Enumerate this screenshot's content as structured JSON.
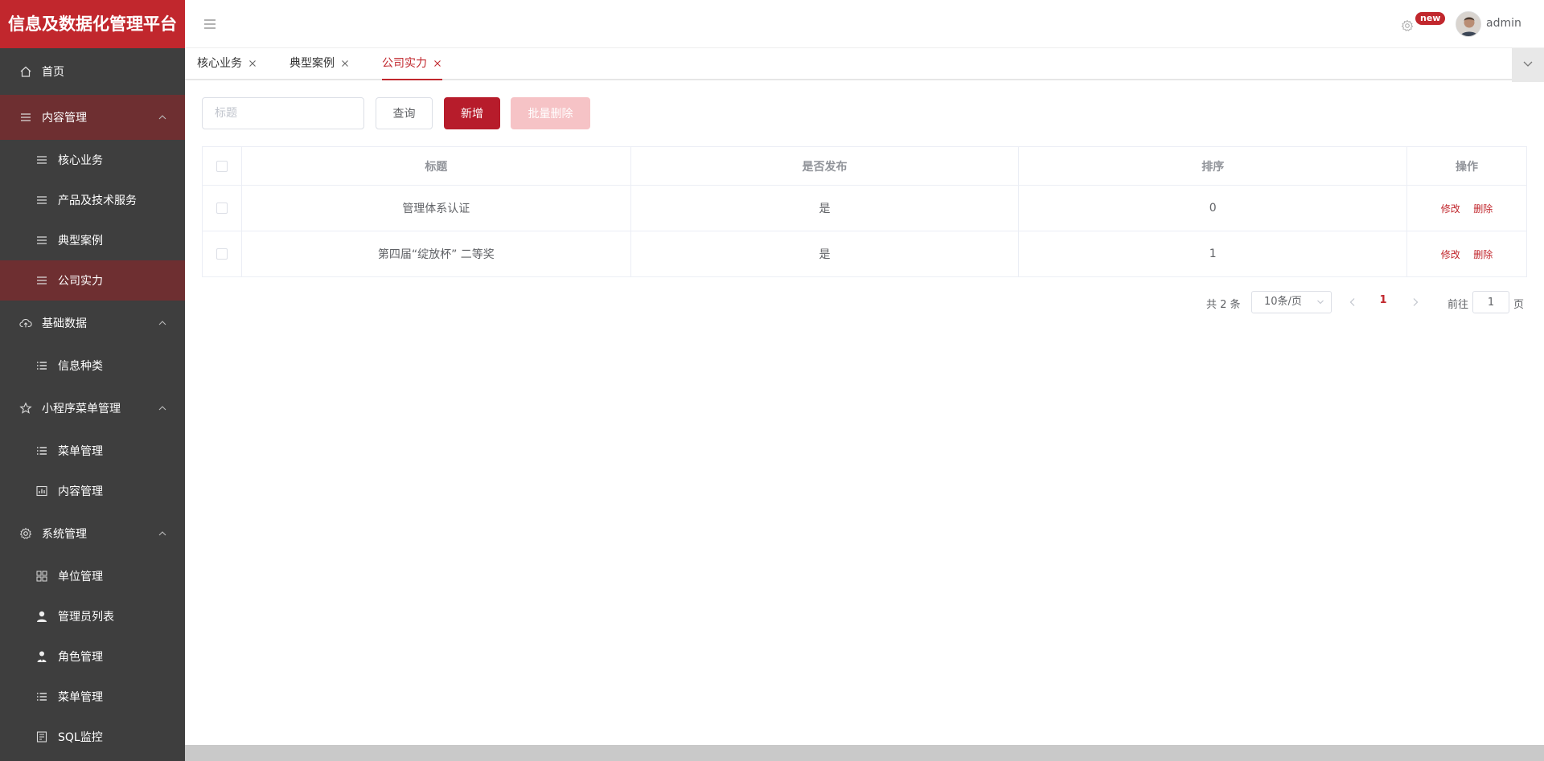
{
  "brand": "信息及数据化管理平台",
  "sidebar": {
    "items": [
      {
        "label": "首页"
      },
      {
        "label": "内容管理"
      },
      {
        "label": "核心业务"
      },
      {
        "label": "产品及技术服务"
      },
      {
        "label": "典型案例"
      },
      {
        "label": "公司实力"
      },
      {
        "label": "基础数据"
      },
      {
        "label": "信息种类"
      },
      {
        "label": "小程序菜单管理"
      },
      {
        "label": "菜单管理"
      },
      {
        "label": "内容管理"
      },
      {
        "label": "系统管理"
      },
      {
        "label": "单位管理"
      },
      {
        "label": "管理员列表"
      },
      {
        "label": "角色管理"
      },
      {
        "label": "菜单管理"
      },
      {
        "label": "SQL监控"
      }
    ]
  },
  "header": {
    "badge": "new",
    "username": "admin"
  },
  "tabs": [
    {
      "label": "核心业务"
    },
    {
      "label": "典型案例"
    },
    {
      "label": "公司实力"
    }
  ],
  "toolbar": {
    "search_placeholder": "标题",
    "query_label": "查询",
    "add_label": "新增",
    "batch_delete_label": "批量删除"
  },
  "table": {
    "headers": [
      "标题",
      "是否发布",
      "排序",
      "操作"
    ],
    "rows": [
      {
        "title": "管理体系认证",
        "published": "是",
        "order": "0",
        "edit": "修改",
        "delete": "删除"
      },
      {
        "title": "第四届“绽放杯” 二等奖",
        "published": "是",
        "order": "1",
        "edit": "修改",
        "delete": "删除"
      }
    ]
  },
  "pager": {
    "total": "共 2 条",
    "page_size": "10条/页",
    "current_page": "1",
    "goto_label": "前往",
    "goto_value": "1",
    "page_label": "页"
  },
  "colors": {
    "brand": "#c1272d",
    "sidebar_bg": "#3e3e3e",
    "sidebar_active": "#6e2f31"
  }
}
